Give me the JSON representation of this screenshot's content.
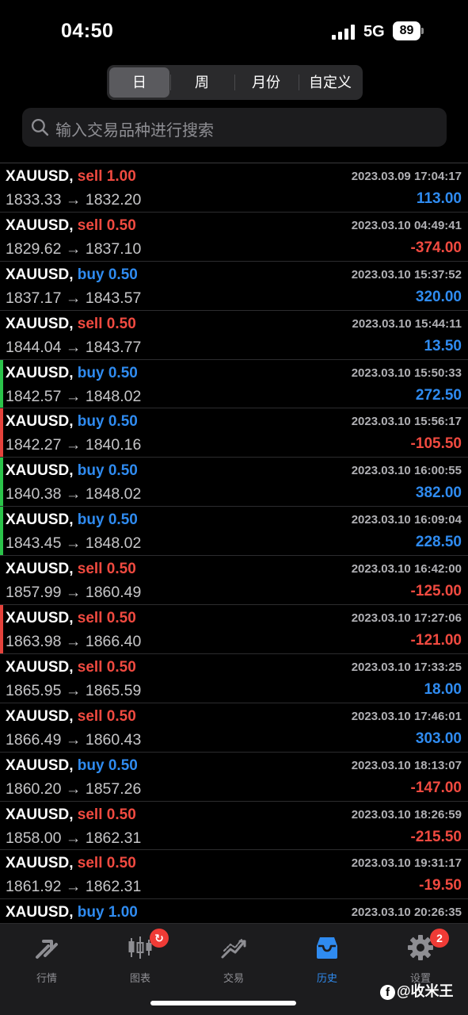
{
  "status": {
    "time": "04:50",
    "network": "5G",
    "battery": "89"
  },
  "segments": [
    "日",
    "周",
    "月份",
    "自定义"
  ],
  "search": {
    "placeholder": "输入交易品种进行搜索"
  },
  "colors": {
    "sell": "#f04a40",
    "buy": "#2f8bf0",
    "loss": "#f04a40",
    "gain": "#2f8bf0",
    "marker_green": "#2bc34a",
    "marker_red": "#e5423b"
  },
  "trades": [
    {
      "symbol": "XAUUSD,",
      "side": "sell",
      "volume": "1.00",
      "open": "1833.33",
      "close": "1832.20",
      "time": "2023.03.09 17:04:17",
      "profit": "113.00",
      "marker": ""
    },
    {
      "symbol": "XAUUSD,",
      "side": "sell",
      "volume": "0.50",
      "open": "1829.62",
      "close": "1837.10",
      "time": "2023.03.10 04:49:41",
      "profit": "-374.00",
      "marker": ""
    },
    {
      "symbol": "XAUUSD,",
      "side": "buy",
      "volume": "0.50",
      "open": "1837.17",
      "close": "1843.57",
      "time": "2023.03.10 15:37:52",
      "profit": "320.00",
      "marker": ""
    },
    {
      "symbol": "XAUUSD,",
      "side": "sell",
      "volume": "0.50",
      "open": "1844.04",
      "close": "1843.77",
      "time": "2023.03.10 15:44:11",
      "profit": "13.50",
      "marker": ""
    },
    {
      "symbol": "XAUUSD,",
      "side": "buy",
      "volume": "0.50",
      "open": "1842.57",
      "close": "1848.02",
      "time": "2023.03.10 15:50:33",
      "profit": "272.50",
      "marker": "green"
    },
    {
      "symbol": "XAUUSD,",
      "side": "buy",
      "volume": "0.50",
      "open": "1842.27",
      "close": "1840.16",
      "time": "2023.03.10 15:56:17",
      "profit": "-105.50",
      "marker": "red"
    },
    {
      "symbol": "XAUUSD,",
      "side": "buy",
      "volume": "0.50",
      "open": "1840.38",
      "close": "1848.02",
      "time": "2023.03.10 16:00:55",
      "profit": "382.00",
      "marker": "green"
    },
    {
      "symbol": "XAUUSD,",
      "side": "buy",
      "volume": "0.50",
      "open": "1843.45",
      "close": "1848.02",
      "time": "2023.03.10 16:09:04",
      "profit": "228.50",
      "marker": "green"
    },
    {
      "symbol": "XAUUSD,",
      "side": "sell",
      "volume": "0.50",
      "open": "1857.99",
      "close": "1860.49",
      "time": "2023.03.10 16:42:00",
      "profit": "-125.00",
      "marker": ""
    },
    {
      "symbol": "XAUUSD,",
      "side": "sell",
      "volume": "0.50",
      "open": "1863.98",
      "close": "1866.40",
      "time": "2023.03.10 17:27:06",
      "profit": "-121.00",
      "marker": "red"
    },
    {
      "symbol": "XAUUSD,",
      "side": "sell",
      "volume": "0.50",
      "open": "1865.95",
      "close": "1865.59",
      "time": "2023.03.10 17:33:25",
      "profit": "18.00",
      "marker": ""
    },
    {
      "symbol": "XAUUSD,",
      "side": "sell",
      "volume": "0.50",
      "open": "1866.49",
      "close": "1860.43",
      "time": "2023.03.10 17:46:01",
      "profit": "303.00",
      "marker": ""
    },
    {
      "symbol": "XAUUSD,",
      "side": "buy",
      "volume": "0.50",
      "open": "1860.20",
      "close": "1857.26",
      "time": "2023.03.10 18:13:07",
      "profit": "-147.00",
      "marker": ""
    },
    {
      "symbol": "XAUUSD,",
      "side": "sell",
      "volume": "0.50",
      "open": "1858.00",
      "close": "1862.31",
      "time": "2023.03.10 18:26:59",
      "profit": "-215.50",
      "marker": ""
    },
    {
      "symbol": "XAUUSD,",
      "side": "sell",
      "volume": "0.50",
      "open": "1861.92",
      "close": "1862.31",
      "time": "2023.03.10 19:31:17",
      "profit": "-19.50",
      "marker": ""
    },
    {
      "symbol": "XAUUSD,",
      "side": "buy",
      "volume": "1.00",
      "open": "",
      "close": "",
      "time": "2023.03.10 20:26:35",
      "profit": "",
      "marker": ""
    }
  ],
  "arrow": "→",
  "tabs": [
    {
      "label": "行情",
      "icon": "quotes-icon",
      "badge": ""
    },
    {
      "label": "图表",
      "icon": "chart-icon",
      "badge": "↻"
    },
    {
      "label": "交易",
      "icon": "trade-icon",
      "badge": ""
    },
    {
      "label": "历史",
      "icon": "history-icon",
      "badge": ""
    },
    {
      "label": "设置",
      "icon": "gear-icon",
      "badge": "2"
    }
  ],
  "active_tab": 3,
  "watermark": {
    "icon": "f",
    "text": "@收米王"
  }
}
